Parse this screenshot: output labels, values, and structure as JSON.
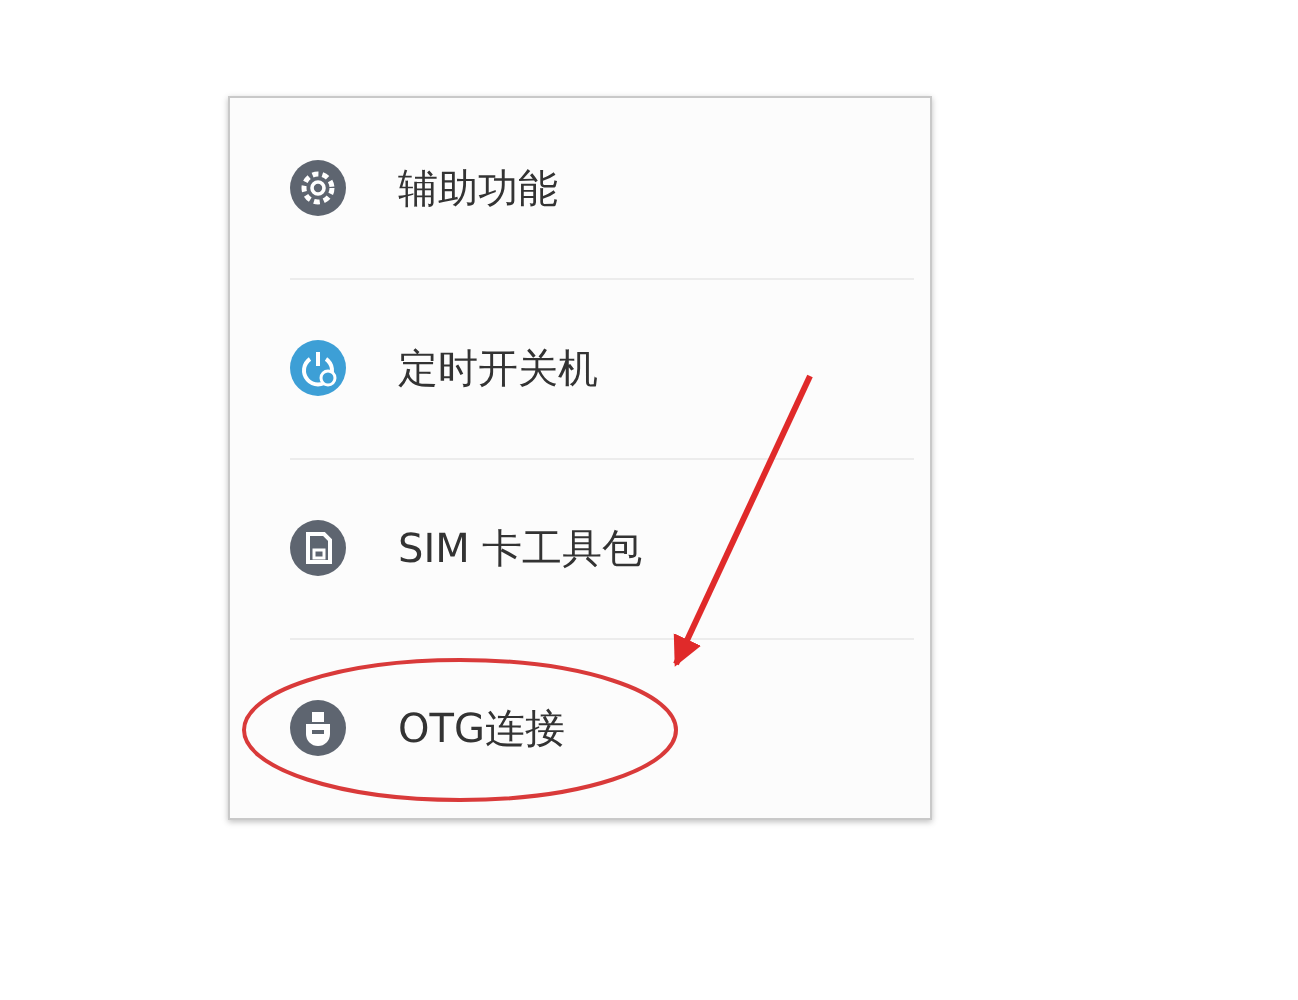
{
  "settings_list": {
    "items": [
      {
        "label": "辅助功能",
        "kind": "gear",
        "circled": false
      },
      {
        "label": "定时开关机",
        "kind": "timer",
        "circled": false
      },
      {
        "label": "SIM 卡工具包",
        "kind": "sim",
        "circled": false
      },
      {
        "label": "OTG连接",
        "kind": "otg",
        "circled": true
      }
    ]
  }
}
